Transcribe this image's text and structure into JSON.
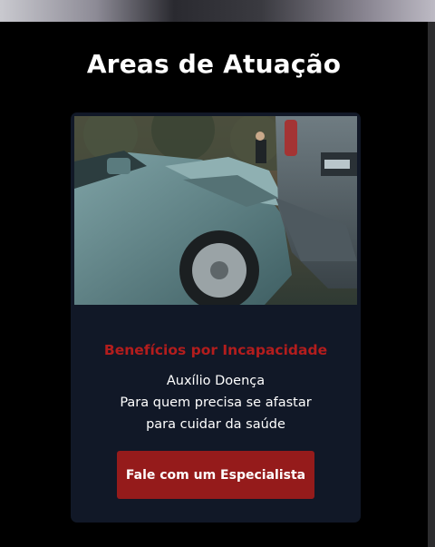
{
  "section": {
    "title": "Areas de Atuação"
  },
  "card": {
    "image_alt": "car-crash-photo",
    "title": "Benefícios por Incapacidade",
    "subtitle": "Auxílio Doença",
    "description": "Para quem precisa se afastar para cuidar da saúde",
    "cta_label": "Fale com um Especialista"
  },
  "colors": {
    "background": "#000000",
    "card_background": "#111827",
    "accent_red": "#b31d1d",
    "button_red": "#951b1b",
    "text_white": "#ffffff"
  }
}
